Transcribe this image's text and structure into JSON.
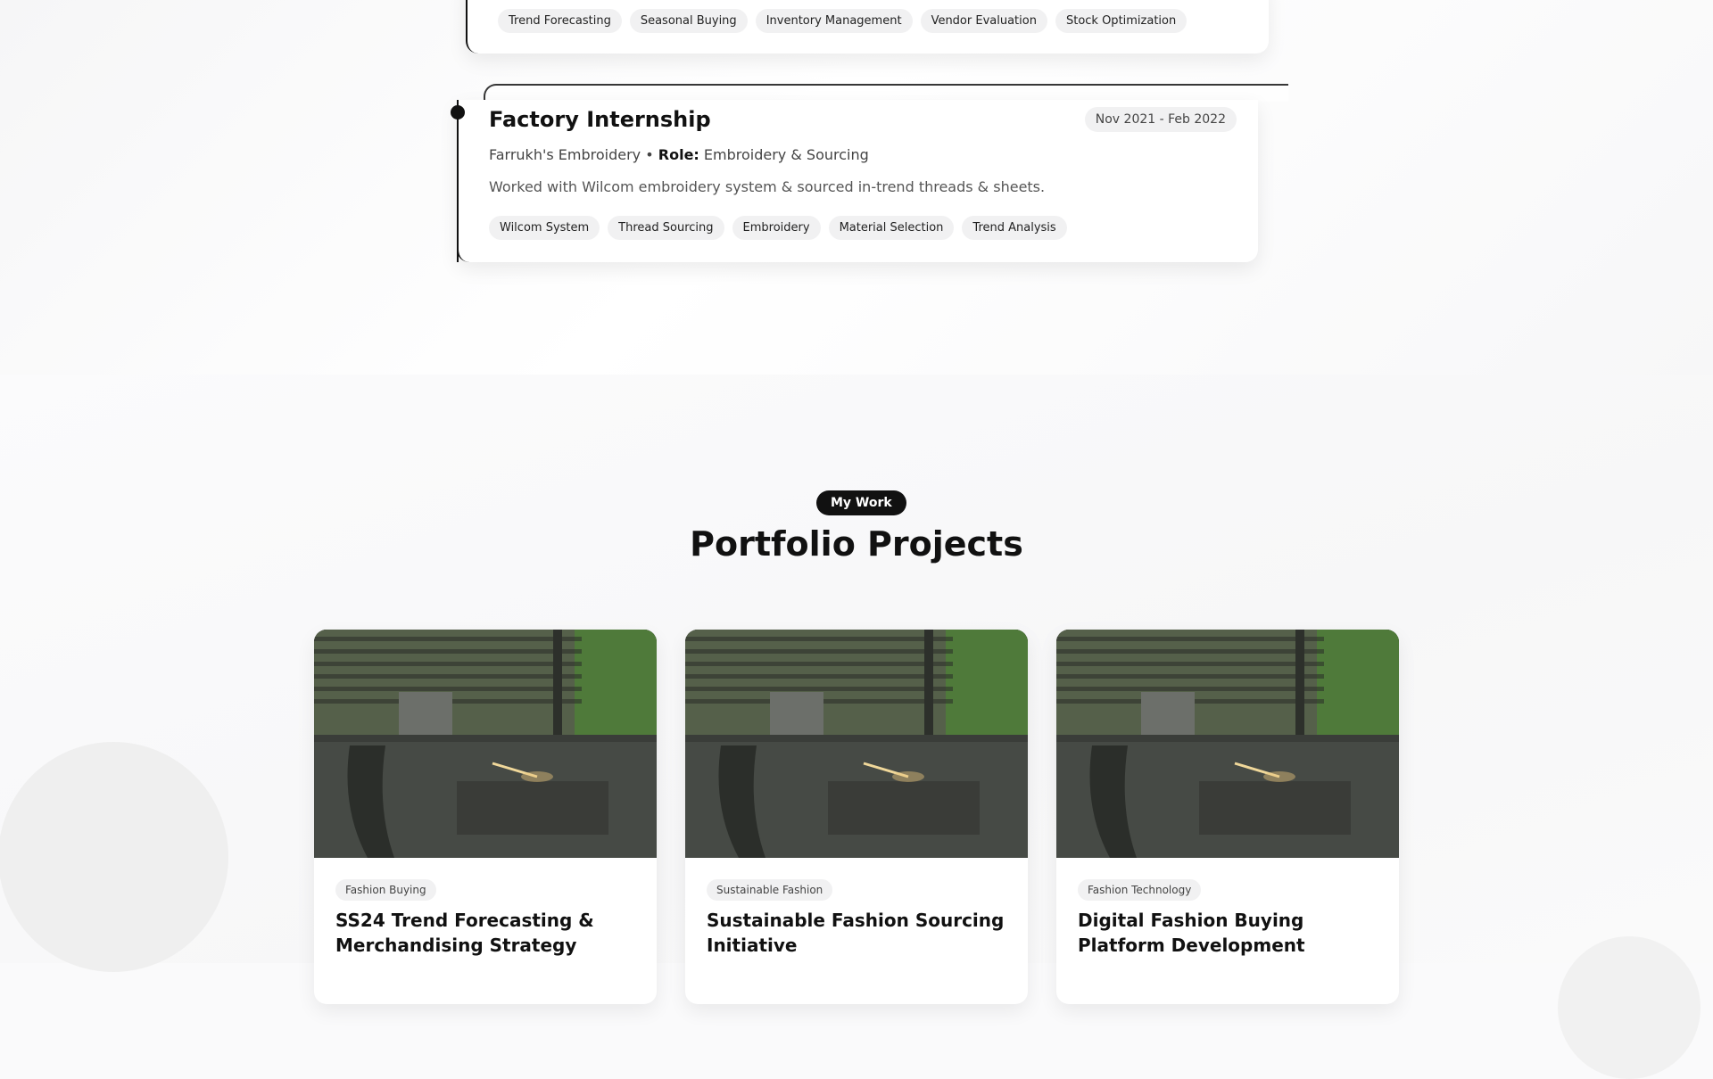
{
  "experience_prev": {
    "tags": [
      "Trend Forecasting",
      "Seasonal Buying",
      "Inventory Management",
      "Vendor Evaluation",
      "Stock Optimization"
    ]
  },
  "experience": {
    "title": "Factory Internship",
    "date": "Nov 2021 - Feb 2022",
    "company": "Farrukh's Embroidery",
    "role_label": "Role:",
    "role": "Embroidery & Sourcing",
    "separator": "•",
    "description": "Worked with Wilcom embroidery system & sourced in-trend threads & sheets.",
    "tags": [
      "Wilcom System",
      "Thread Sourcing",
      "Embroidery",
      "Material Selection",
      "Trend Analysis"
    ]
  },
  "portfolio": {
    "badge": "My Work",
    "title": "Portfolio Projects",
    "projects": [
      {
        "category": "Fashion Buying",
        "title": "SS24 Trend Forecasting & Merchandising Strategy"
      },
      {
        "category": "Sustainable Fashion",
        "title": "Sustainable Fashion Sourcing Initiative"
      },
      {
        "category": "Fashion Technology",
        "title": "Digital Fashion Buying Platform Development"
      }
    ]
  },
  "colors": {
    "accent": "#111111",
    "tag_bg": "#f1f1f2"
  }
}
